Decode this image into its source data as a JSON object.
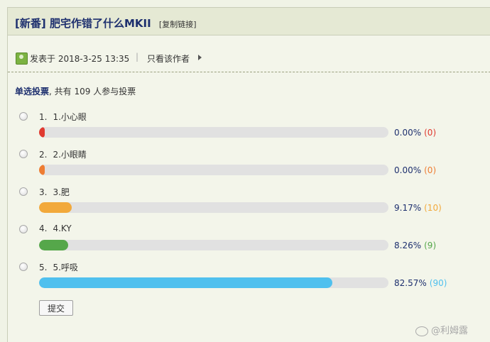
{
  "thread": {
    "tag": "[新番]",
    "title": "肥宅作错了什么MKII",
    "copy_link": "[复制链接]"
  },
  "meta": {
    "posted": "发表于 2018-3-25 13:35",
    "separator": "|",
    "author_only": "只看该作者"
  },
  "poll": {
    "type_label": "单选投票",
    "summary_prefix": ", 共有 ",
    "voters": "109",
    "summary_suffix": " 人参与投票",
    "options": [
      {
        "num": "1.",
        "label": "1.小心眼",
        "fraction": 0.0,
        "percent": "0.00%",
        "count": "(0)",
        "color": "#e03a30"
      },
      {
        "num": "2.",
        "label": "2.小眼睛",
        "fraction": 0.0,
        "percent": "0.00%",
        "count": "(0)",
        "color": "#ee7d33"
      },
      {
        "num": "3.",
        "label": "3.肥",
        "fraction": 0.0917,
        "percent": "9.17%",
        "count": "(10)",
        "color": "#f2a93b"
      },
      {
        "num": "4.",
        "label": "4.KY",
        "fraction": 0.0826,
        "percent": "8.26%",
        "count": "(9)",
        "color": "#55a74a"
      },
      {
        "num": "5.",
        "label": "5.呼吸",
        "fraction": 0.8257,
        "percent": "82.57%",
        "count": "(90)",
        "color": "#4fc0ee"
      }
    ],
    "submit_label": "提交"
  },
  "watermark": "@利姆露"
}
